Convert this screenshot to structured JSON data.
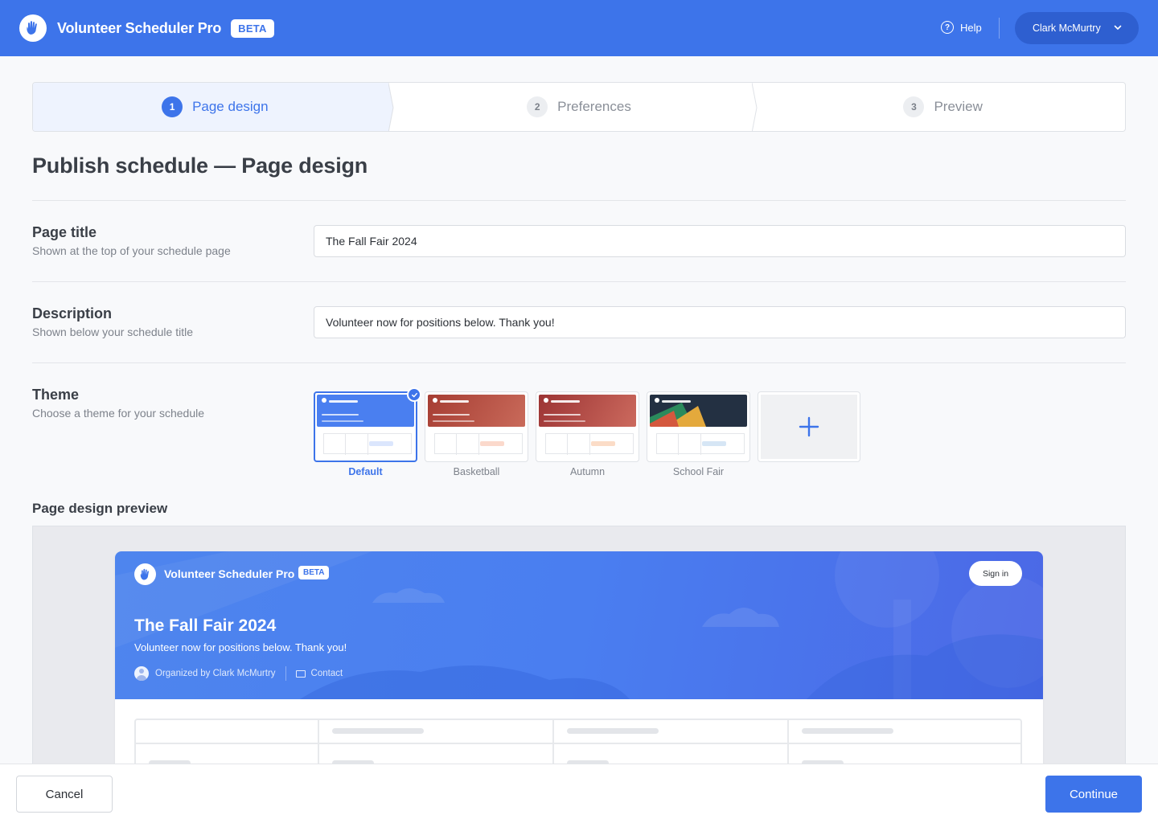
{
  "header": {
    "app_name": "Volunteer Scheduler Pro",
    "beta_badge": "BETA",
    "help_label": "Help",
    "user_name": "Clark McMurtry",
    "brand_color": "#3d74ea"
  },
  "stepper": {
    "steps": [
      {
        "number": "1",
        "label": "Page design",
        "active": true
      },
      {
        "number": "2",
        "label": "Preferences",
        "active": false
      },
      {
        "number": "3",
        "label": "Preview",
        "active": false
      }
    ]
  },
  "page_title": "Publish schedule — Page design",
  "form": {
    "title": {
      "label": "Page title",
      "help": "Shown at the top of your schedule page",
      "value": "The Fall Fair 2024"
    },
    "description": {
      "label": "Description",
      "help": "Shown below your schedule title",
      "value": "Volunteer now for positions below. Thank you!"
    },
    "theme": {
      "label": "Theme",
      "help": "Choose a theme for your schedule",
      "options": [
        {
          "name": "Default",
          "selected": true,
          "color": "#4a7ff0"
        },
        {
          "name": "Basketball",
          "selected": false,
          "color": "#b84a3e"
        },
        {
          "name": "Autumn",
          "selected": false,
          "color": "#b34545"
        },
        {
          "name": "School Fair",
          "selected": false,
          "color": "#233042"
        }
      ],
      "add_icon": "plus-icon"
    }
  },
  "preview": {
    "section_title": "Page design preview",
    "app_name": "Volunteer Scheduler Pro",
    "beta_badge": "BETA",
    "sign_in": "Sign in",
    "title": "The Fall Fair 2024",
    "description": "Volunteer now for positions below. Thank you!",
    "organizer": "Organized by Clark McMurtry",
    "contact": "Contact"
  },
  "footer": {
    "cancel_label": "Cancel",
    "continue_label": "Continue"
  }
}
